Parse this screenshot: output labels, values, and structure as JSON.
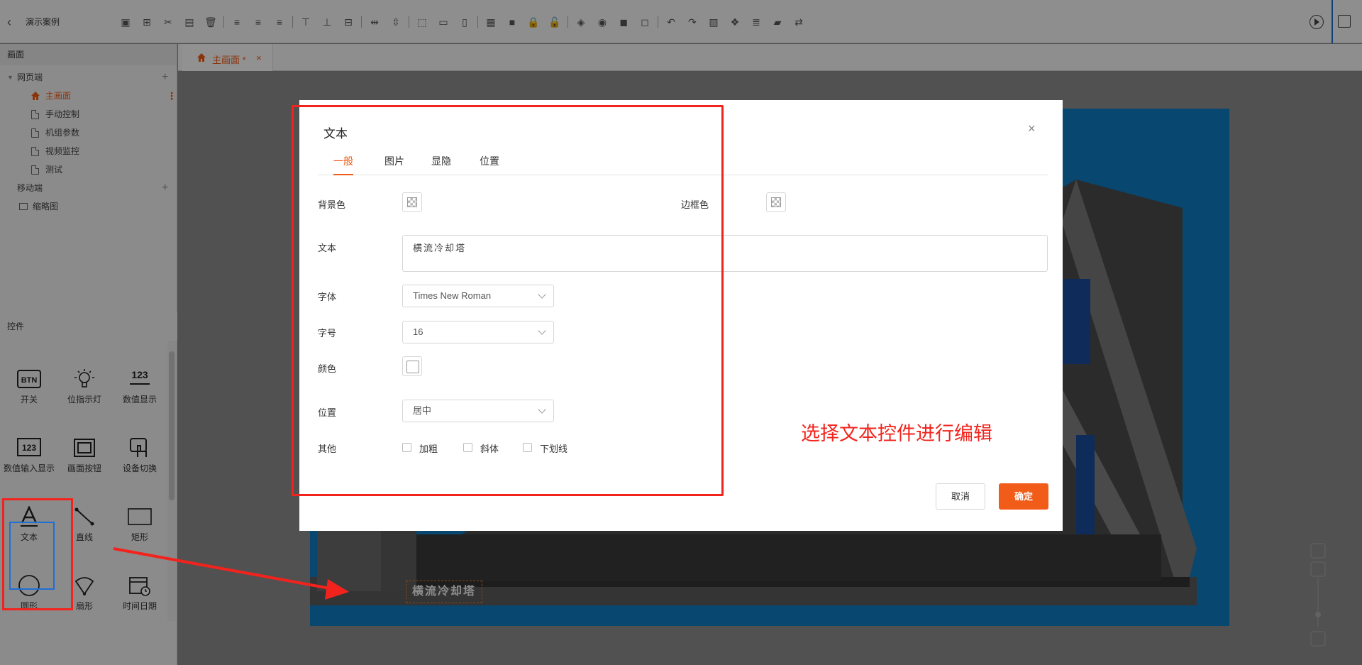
{
  "app": {
    "project_title": "演示案例"
  },
  "toolbar": {
    "icons": [
      "save-icon",
      "save-as-icon",
      "cut-icon",
      "paste-icon",
      "delete-icon",
      "|",
      "align-left-icon",
      "align-center-icon",
      "align-right-icon",
      "|",
      "align-top-icon",
      "align-bottom-icon",
      "align-middle-icon",
      "|",
      "distribute-h-icon",
      "distribute-v-icon",
      "|",
      "same-width-icon",
      "same-height-icon",
      "same-size-icon",
      "|",
      "group-icon",
      "ungroup-icon",
      "lock-icon",
      "unlock-icon",
      "|",
      "bring-front-icon",
      "send-back-icon",
      "bring-forward-icon",
      "send-backward-icon",
      "|",
      "undo-icon",
      "redo-icon",
      "image-icon",
      "component-icon",
      "layer-icon",
      "clapper-icon",
      "swap-icon"
    ]
  },
  "sidebar": {
    "screens_header": "画面",
    "web_group": "网页端",
    "pages": [
      {
        "label": "主画面",
        "active": true
      },
      {
        "label": "手动控制"
      },
      {
        "label": "机组参数"
      },
      {
        "label": "视频监控"
      },
      {
        "label": "测试"
      }
    ],
    "mobile_group": "移动端",
    "thumbnail": "缩略图",
    "controls_header": "控件",
    "controls": [
      {
        "label": "开关",
        "icon": "BTN"
      },
      {
        "label": "位指示灯",
        "icon": "bulb"
      },
      {
        "label": "数值显示",
        "icon": "123"
      },
      {
        "label": "数值输入显示",
        "icon": "123box"
      },
      {
        "label": "画面按钮",
        "icon": "frame"
      },
      {
        "label": "设备切换",
        "icon": "hand"
      },
      {
        "label": "文本",
        "icon": "A"
      },
      {
        "label": "直线",
        "icon": "line"
      },
      {
        "label": "矩形",
        "icon": "rect"
      },
      {
        "label": "圆形",
        "icon": "circle"
      },
      {
        "label": "扇形",
        "icon": "sector"
      },
      {
        "label": "时间日期",
        "icon": "calendar"
      }
    ]
  },
  "tabs": {
    "main_tab": "主画面 *",
    "close": "×"
  },
  "canvas": {
    "text_widget": "横流冷却塔"
  },
  "modal": {
    "title": "文本",
    "close": "×",
    "tabs": [
      "一般",
      "图片",
      "显隐",
      "位置"
    ],
    "active_tab": 0,
    "labels": {
      "bg_color": "背景色",
      "border_color": "边框色",
      "text": "文本",
      "font": "字体",
      "size": "字号",
      "color": "颜色",
      "position": "位置",
      "other": "其他"
    },
    "values": {
      "text": "横流冷却塔",
      "font": "Times New Roman",
      "size": "16",
      "position": "居中"
    },
    "options": {
      "bold": "加粗",
      "italic": "斜体",
      "underline": "下划线"
    },
    "buttons": {
      "cancel": "取消",
      "ok": "确定"
    }
  },
  "annotation": {
    "text": "选择文本控件进行编辑"
  },
  "colors": {
    "accent": "#ef5b14",
    "annotation": "#f2231d",
    "stage": "#0f7bc0",
    "selection": "#1e6fd6"
  }
}
